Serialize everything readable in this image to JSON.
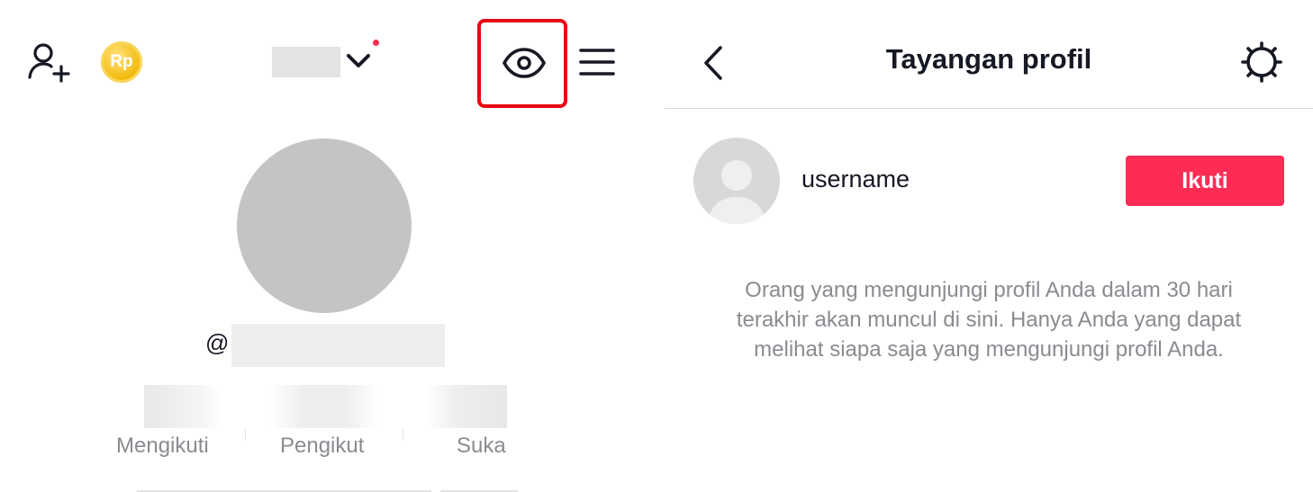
{
  "left_profile": {
    "coin_label": "Rp",
    "at_symbol": "@",
    "stats": [
      {
        "label": "Mengikuti"
      },
      {
        "label": "Pengikut"
      },
      {
        "label": "Suka"
      }
    ]
  },
  "profile_views": {
    "title": "Tayangan profil",
    "visitor": {
      "username": "username"
    },
    "follow_label": "Ikuti",
    "info_lines": [
      "Orang yang mengunjungi profil Anda dalam 30 hari",
      "terakhir akan muncul di sini. Hanya Anda yang dapat",
      "melihat siapa saja yang mengunjungi profil Anda."
    ]
  },
  "colors": {
    "accent": "#fe2c55",
    "highlight_box": "#e50914",
    "muted_text": "#8a8b91",
    "coin": "#f2b705"
  }
}
